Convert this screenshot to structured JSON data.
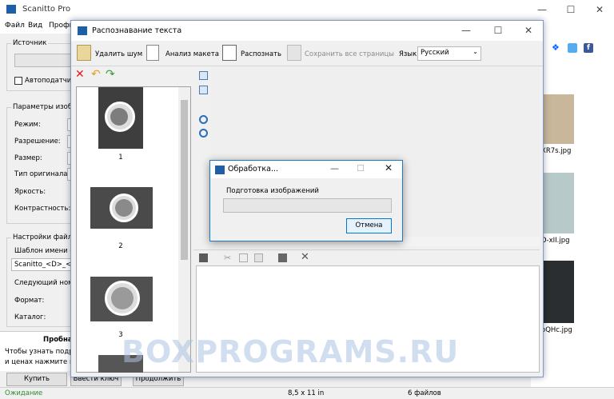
{
  "main_window": {
    "title": "Scanitto Pro",
    "menu": [
      "Файл",
      "Вид",
      "Профи"
    ],
    "source_group": "Источник",
    "autofeed_label": "Автоподатчик",
    "scan_params_group": "Параметры изобра",
    "params": [
      "Режим:",
      "Разрешение:",
      "Размер:",
      "Тип оригинала:",
      "Яркость:",
      "Контрастность:"
    ],
    "file_settings_group": "Настройки файла",
    "template_label": "Шаблон имени фай",
    "template_value": "Scanitto_<D>_<#",
    "next_number_label": "Следующий номер",
    "format_label": "Формат:",
    "catalog_label": "Каталог:",
    "promo_title": "Пробна",
    "promo_line1": "Чтобы узнать подро",
    "promo_line2": "и ценах нажмите кно",
    "buy_button": "Купить",
    "enter_key_button": "Ввести ключ",
    "continue_button": "Продолжить",
    "status_left": "Ожидание",
    "status_size": "8,5 x 11 in",
    "status_files": "6 файлов"
  },
  "right_panel": {
    "files": [
      "XR7s.jpg",
      "D-xII.jpg",
      "oQHc.jpg"
    ],
    "social_icons": [
      "dropbox-icon",
      "twitter-icon",
      "facebook-icon"
    ]
  },
  "ocr_dialog": {
    "title": "Распознавание текста",
    "toolbar": {
      "remove_noise": "Удалить шум",
      "layout_analysis": "Анализ макета",
      "recognize": "Распознать",
      "save_all_pages": "Сохранить все страницы",
      "language_label": "Язык",
      "language_value": "Русский"
    },
    "pages": [
      "1",
      "2",
      "3"
    ]
  },
  "processing_dialog": {
    "title": "Обработка...",
    "message": "Подготовка изображений",
    "cancel_button": "Отмена",
    "progress": 0
  },
  "watermark": "BOXPROGRAMS.RU"
}
